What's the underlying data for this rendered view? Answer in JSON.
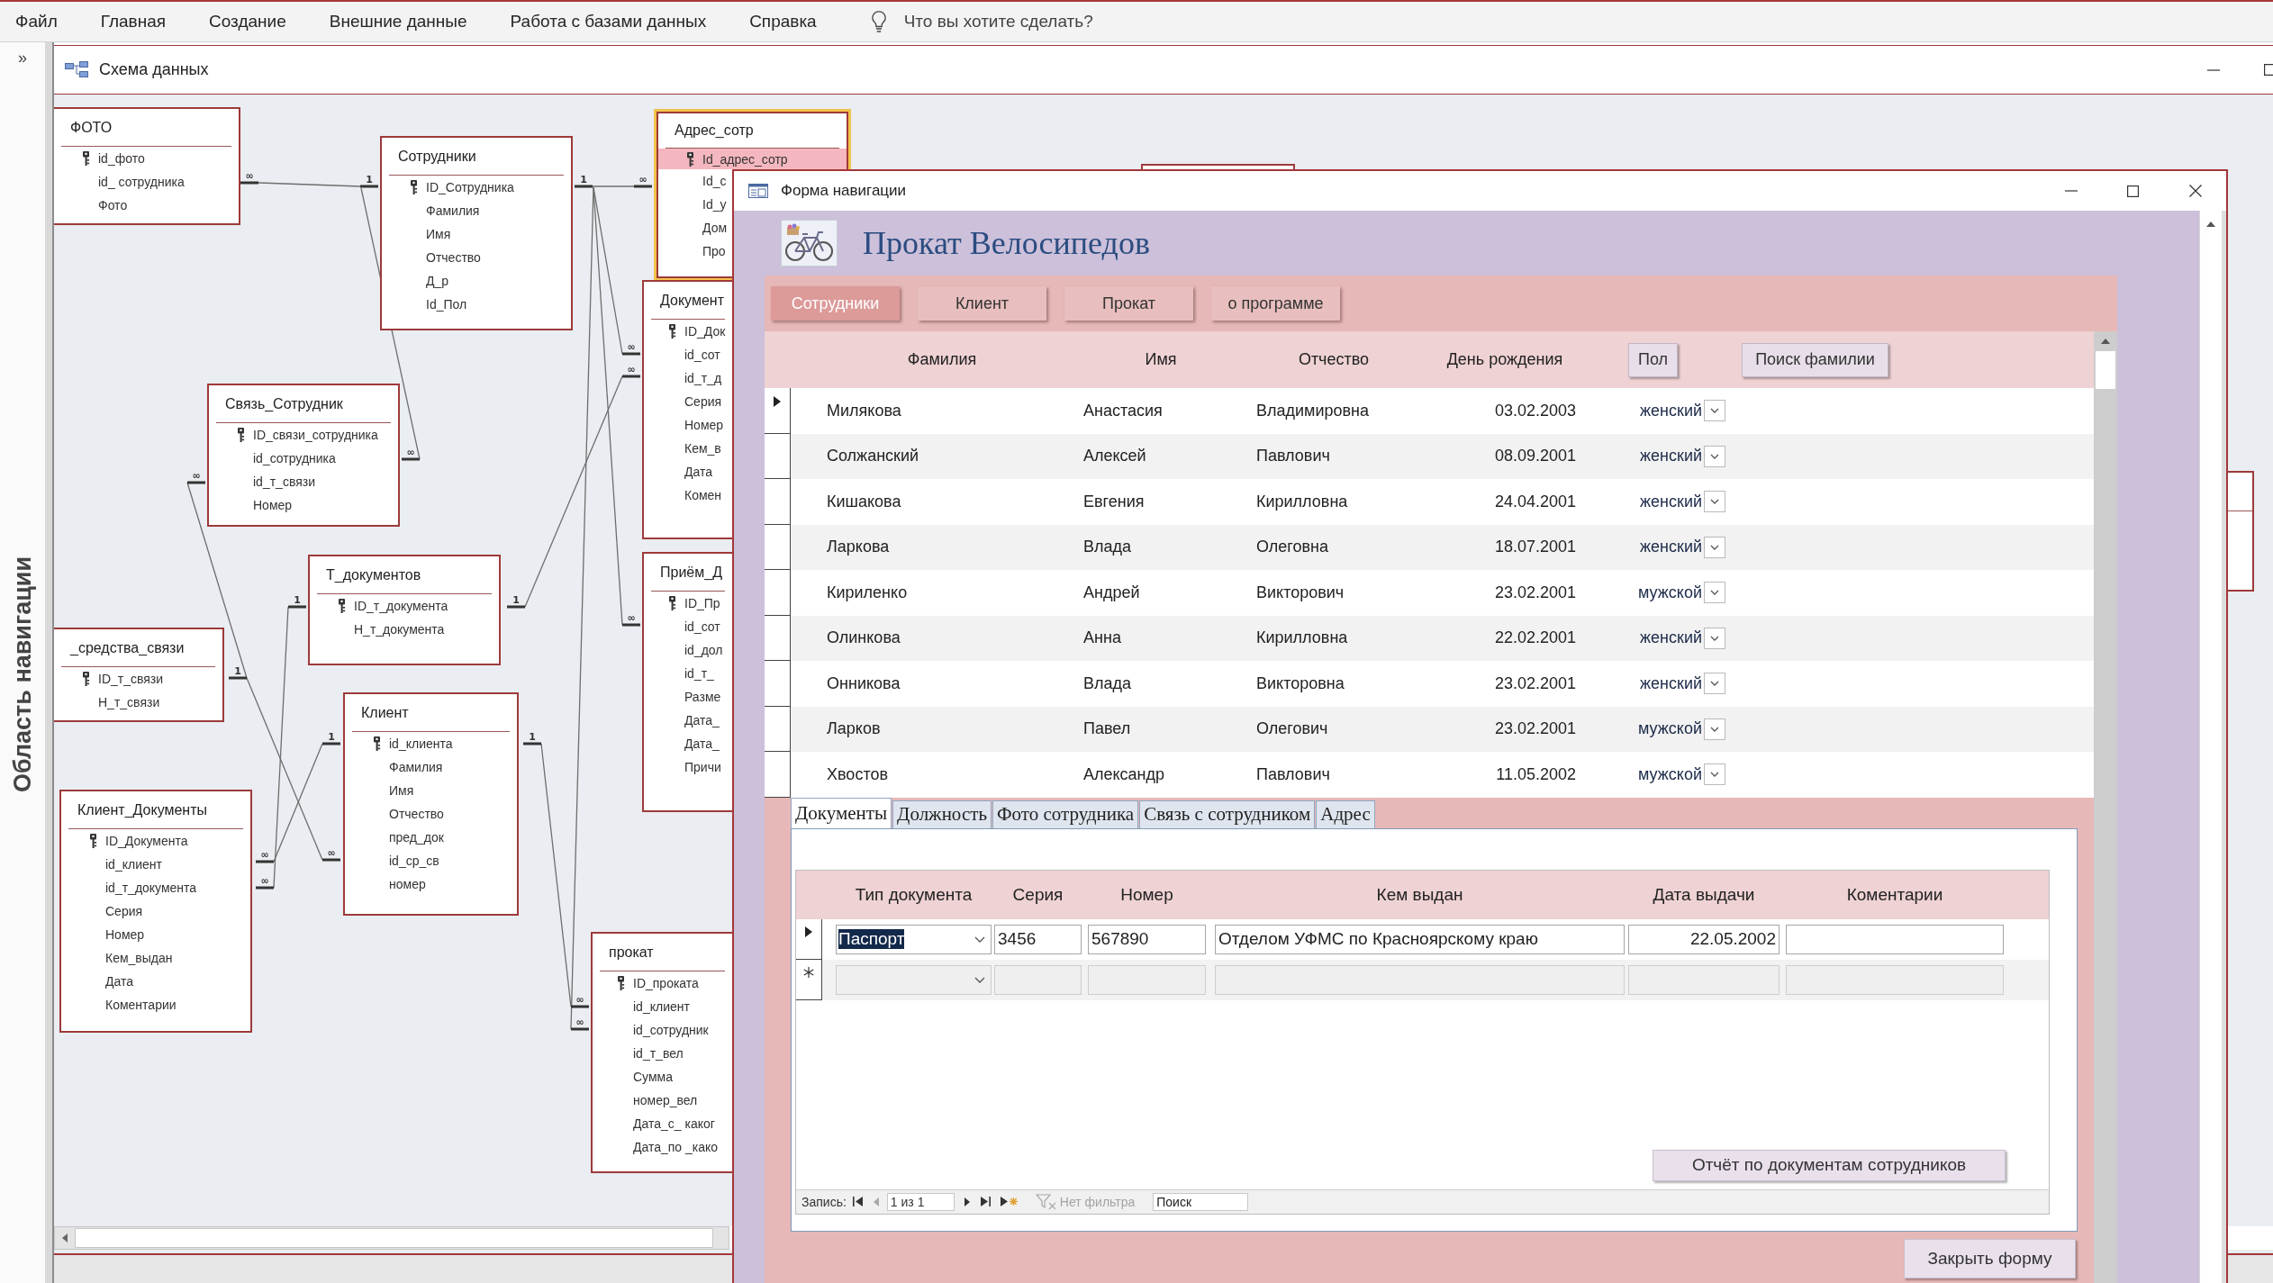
{
  "menu_bar": {
    "items": [
      {
        "label": "Файл"
      },
      {
        "label": "Главная"
      },
      {
        "label": "Создание"
      },
      {
        "label": "Внешние данные"
      },
      {
        "label": "Работа с базами данных"
      },
      {
        "label": "Справка"
      }
    ],
    "tell_me": {
      "placeholder": "Что вы хотите сделать?"
    }
  },
  "navigation_pane": {
    "toggle": "»",
    "title": "Область навигации"
  },
  "document": {
    "title": "Схема данных"
  },
  "diagram": {
    "tables": [
      {
        "title": "ФОТО",
        "selected": false,
        "fields": [
          {
            "name": "id_фото",
            "primary_key": true,
            "selected": false
          },
          {
            "name": "id_ сотрудника",
            "primary_key": false,
            "selected": false
          },
          {
            "name": "Фото",
            "primary_key": false,
            "selected": false
          }
        ]
      },
      {
        "title": "Адрес_сотр",
        "selected": true,
        "fields": [
          {
            "name": "Id_адрес_сотр",
            "primary_key": true,
            "selected": true
          },
          {
            "name": "Id_с",
            "primary_key": false,
            "selected": false
          },
          {
            "name": "Id_у",
            "primary_key": false,
            "selected": false
          },
          {
            "name": "Дом",
            "primary_key": false,
            "selected": false
          },
          {
            "name": "Про",
            "primary_key": false,
            "selected": false
          }
        ]
      },
      {
        "title": "Сотрудники",
        "selected": false,
        "fields": [
          {
            "name": "ID_Сотрудника",
            "primary_key": true,
            "selected": false
          },
          {
            "name": "Фамилия",
            "primary_key": false,
            "selected": false
          },
          {
            "name": "Имя",
            "primary_key": false,
            "selected": false
          },
          {
            "name": "Отчество",
            "primary_key": false,
            "selected": false
          },
          {
            "name": "Д_р",
            "primary_key": false,
            "selected": false
          },
          {
            "name": "Id_Пол",
            "primary_key": false,
            "selected": false
          }
        ]
      },
      {
        "title": "Документ",
        "selected": false,
        "fields": [
          {
            "name": "ID_Док",
            "primary_key": true,
            "selected": false
          },
          {
            "name": "id_сот",
            "primary_key": false,
            "selected": false
          },
          {
            "name": "id_т_д",
            "primary_key": false,
            "selected": false
          },
          {
            "name": "Серия",
            "primary_key": false,
            "selected": false
          },
          {
            "name": "Номер",
            "primary_key": false,
            "selected": false
          },
          {
            "name": "Кем_в",
            "primary_key": false,
            "selected": false
          },
          {
            "name": "Дата",
            "primary_key": false,
            "selected": false
          },
          {
            "name": "Комен",
            "primary_key": false,
            "selected": false
          }
        ]
      },
      {
        "title": "Связь_Сотрудник",
        "selected": false,
        "fields": [
          {
            "name": "ID_связи_сотрудника",
            "primary_key": true,
            "selected": false
          },
          {
            "name": "id_сотрудника",
            "primary_key": false,
            "selected": false
          },
          {
            "name": "id_т_связи",
            "primary_key": false,
            "selected": false
          },
          {
            "name": "Номер",
            "primary_key": false,
            "selected": false
          }
        ]
      },
      {
        "title": "Т_документов",
        "selected": false,
        "fields": [
          {
            "name": "ID_т_документа",
            "primary_key": true,
            "selected": false
          },
          {
            "name": "Н_т_документа",
            "primary_key": false,
            "selected": false
          }
        ]
      },
      {
        "title": "Приём_Д",
        "selected": false,
        "fields": [
          {
            "name": "ID_Пр",
            "primary_key": true,
            "selected": false
          },
          {
            "name": "id_сот",
            "primary_key": false,
            "selected": false
          },
          {
            "name": "id_дол",
            "primary_key": false,
            "selected": false
          },
          {
            "name": "id_т_",
            "primary_key": false,
            "selected": false
          },
          {
            "name": "Разме",
            "primary_key": false,
            "selected": false
          },
          {
            "name": "Дата_",
            "primary_key": false,
            "selected": false
          },
          {
            "name": "Дата_",
            "primary_key": false,
            "selected": false
          },
          {
            "name": "Причи",
            "primary_key": false,
            "selected": false
          }
        ]
      },
      {
        "title": "_средства_связи",
        "selected": false,
        "fields": [
          {
            "name": "ID_т_связи",
            "primary_key": true,
            "selected": false
          },
          {
            "name": "Н_т_связи",
            "primary_key": false,
            "selected": false
          }
        ]
      },
      {
        "title": "Клиент",
        "selected": false,
        "fields": [
          {
            "name": "id_клиента",
            "primary_key": true,
            "selected": false
          },
          {
            "name": "Фамилия",
            "primary_key": false,
            "selected": false
          },
          {
            "name": "Имя",
            "primary_key": false,
            "selected": false
          },
          {
            "name": "Отчество",
            "primary_key": false,
            "selected": false
          },
          {
            "name": "пред_док",
            "primary_key": false,
            "selected": false
          },
          {
            "name": "id_ср_св",
            "primary_key": false,
            "selected": false
          },
          {
            "name": "номер",
            "primary_key": false,
            "selected": false
          }
        ]
      },
      {
        "title": "Клиент_Документы",
        "selected": false,
        "fields": [
          {
            "name": "ID_Документа",
            "primary_key": true,
            "selected": false
          },
          {
            "name": "id_клиент",
            "primary_key": false,
            "selected": false
          },
          {
            "name": "id_т_документа",
            "primary_key": false,
            "selected": false
          },
          {
            "name": "Серия",
            "primary_key": false,
            "selected": false
          },
          {
            "name": "Номер",
            "primary_key": false,
            "selected": false
          },
          {
            "name": "Кем_выдан",
            "primary_key": false,
            "selected": false
          },
          {
            "name": "Дата",
            "primary_key": false,
            "selected": false
          },
          {
            "name": "Коментарии",
            "primary_key": false,
            "selected": false
          }
        ]
      },
      {
        "title": "прокат",
        "selected": false,
        "fields": [
          {
            "name": "ID_проката",
            "primary_key": true,
            "selected": false
          },
          {
            "name": "id_клиент",
            "primary_key": false,
            "selected": false
          },
          {
            "name": "id_сотрудник",
            "primary_key": false,
            "selected": false
          },
          {
            "name": "id_т_вел",
            "primary_key": false,
            "selected": false
          },
          {
            "name": "Сумма",
            "primary_key": false,
            "selected": false
          },
          {
            "name": "номер_вел",
            "primary_key": false,
            "selected": false
          },
          {
            "name": "Дата_с_ каког",
            "primary_key": false,
            "selected": false
          },
          {
            "name": "Дата_по _како",
            "primary_key": false,
            "selected": false
          }
        ]
      }
    ],
    "cardinality_marks": [
      {
        "label": "∞"
      },
      {
        "label": "1"
      },
      {
        "label": "1"
      },
      {
        "label": "∞"
      },
      {
        "label": "∞"
      },
      {
        "label": "∞"
      },
      {
        "label": "∞"
      },
      {
        "label": "∞"
      },
      {
        "label": "1"
      },
      {
        "label": "1"
      },
      {
        "label": "∞"
      },
      {
        "label": "1"
      },
      {
        "label": "1"
      },
      {
        "label": "1"
      },
      {
        "label": "∞"
      },
      {
        "label": "∞"
      },
      {
        "label": "∞"
      },
      {
        "label": "∞"
      },
      {
        "label": "∞"
      }
    ]
  },
  "form_window": {
    "title": "Форма навигации",
    "heading": "Прокат Велосипедов",
    "nav_buttons": [
      {
        "label": "Сотрудники",
        "selected": true
      },
      {
        "label": "Клиент",
        "selected": false
      },
      {
        "label": "Прокат",
        "selected": false
      },
      {
        "label": "о программе",
        "selected": false
      }
    ],
    "employees": {
      "columns": [
        {
          "label": "Фамилия",
          "kind": "label"
        },
        {
          "label": "Имя",
          "kind": "label"
        },
        {
          "label": "Отчество",
          "kind": "label"
        },
        {
          "label": "День рождения",
          "kind": "label"
        },
        {
          "label": "Пол",
          "kind": "button"
        },
        {
          "label": "Поиск фамилии",
          "kind": "button"
        }
      ],
      "rows": [
        {
          "selected": true,
          "surname": "Милякова",
          "name": "Анастасия",
          "patronymic": "Владимировна",
          "birthday": "03.02.2003",
          "gender": "женский"
        },
        {
          "selected": false,
          "surname": "Солжанский",
          "name": "Алексей",
          "patronymic": "Павлович",
          "birthday": "08.09.2001",
          "gender": "женский"
        },
        {
          "selected": false,
          "surname": "Кишакова",
          "name": "Евгения",
          "patronymic": "Кирилловна",
          "birthday": "24.04.2001",
          "gender": "женский"
        },
        {
          "selected": false,
          "surname": "Ларкова",
          "name": "Влада",
          "patronymic": "Олеговна",
          "birthday": "18.07.2001",
          "gender": "женский"
        },
        {
          "selected": false,
          "surname": "Кириленко",
          "name": "Андрей",
          "patronymic": "Викторович",
          "birthday": "23.02.2001",
          "gender": "мужской"
        },
        {
          "selected": false,
          "surname": "Олинкова",
          "name": "Анна",
          "patronymic": "Кирилловна",
          "birthday": "22.02.2001",
          "gender": "женский"
        },
        {
          "selected": false,
          "surname": "Онникова",
          "name": "Влада",
          "patronymic": "Викторовна",
          "birthday": "23.02.2001",
          "gender": "женский"
        },
        {
          "selected": false,
          "surname": "Ларков",
          "name": "Павел",
          "patronymic": "Олегович",
          "birthday": "23.02.2001",
          "gender": "мужской"
        },
        {
          "selected": false,
          "surname": "Хвостов",
          "name": "Александр",
          "patronymic": "Павлович",
          "birthday": "11.05.2002",
          "gender": "мужской"
        }
      ]
    },
    "tabs": [
      {
        "label": "Документы",
        "selected": true
      },
      {
        "label": "Должность",
        "selected": false
      },
      {
        "label": "Фото сотрудника",
        "selected": false
      },
      {
        "label": "Связь с сотрудником",
        "selected": false
      },
      {
        "label": "Адрес",
        "selected": false
      }
    ],
    "documents": {
      "columns": [
        "Тип документа",
        "Серия",
        "Номер",
        "Кем выдан",
        "Дата выдачи",
        "Коментарии"
      ],
      "rows": [
        {
          "kind": "record",
          "selected": true,
          "type": {
            "value": "Паспорт",
            "highlighted": true
          },
          "series": "3456",
          "number": "567890",
          "issued_by": "Отделом УФМС по Красноярскому краю",
          "issue_date": "22.05.2002"
        },
        {
          "kind": "new",
          "selected": false
        }
      ],
      "report_button": "Отчёт по документам сотрудников",
      "record_nav": {
        "label": "Запись:",
        "position": "1 из 1",
        "filter": {
          "label": "Нет фильтра",
          "disabled": true
        },
        "search": {
          "placeholder": "Поиск"
        }
      }
    },
    "close_button": "Закрыть форму"
  }
}
